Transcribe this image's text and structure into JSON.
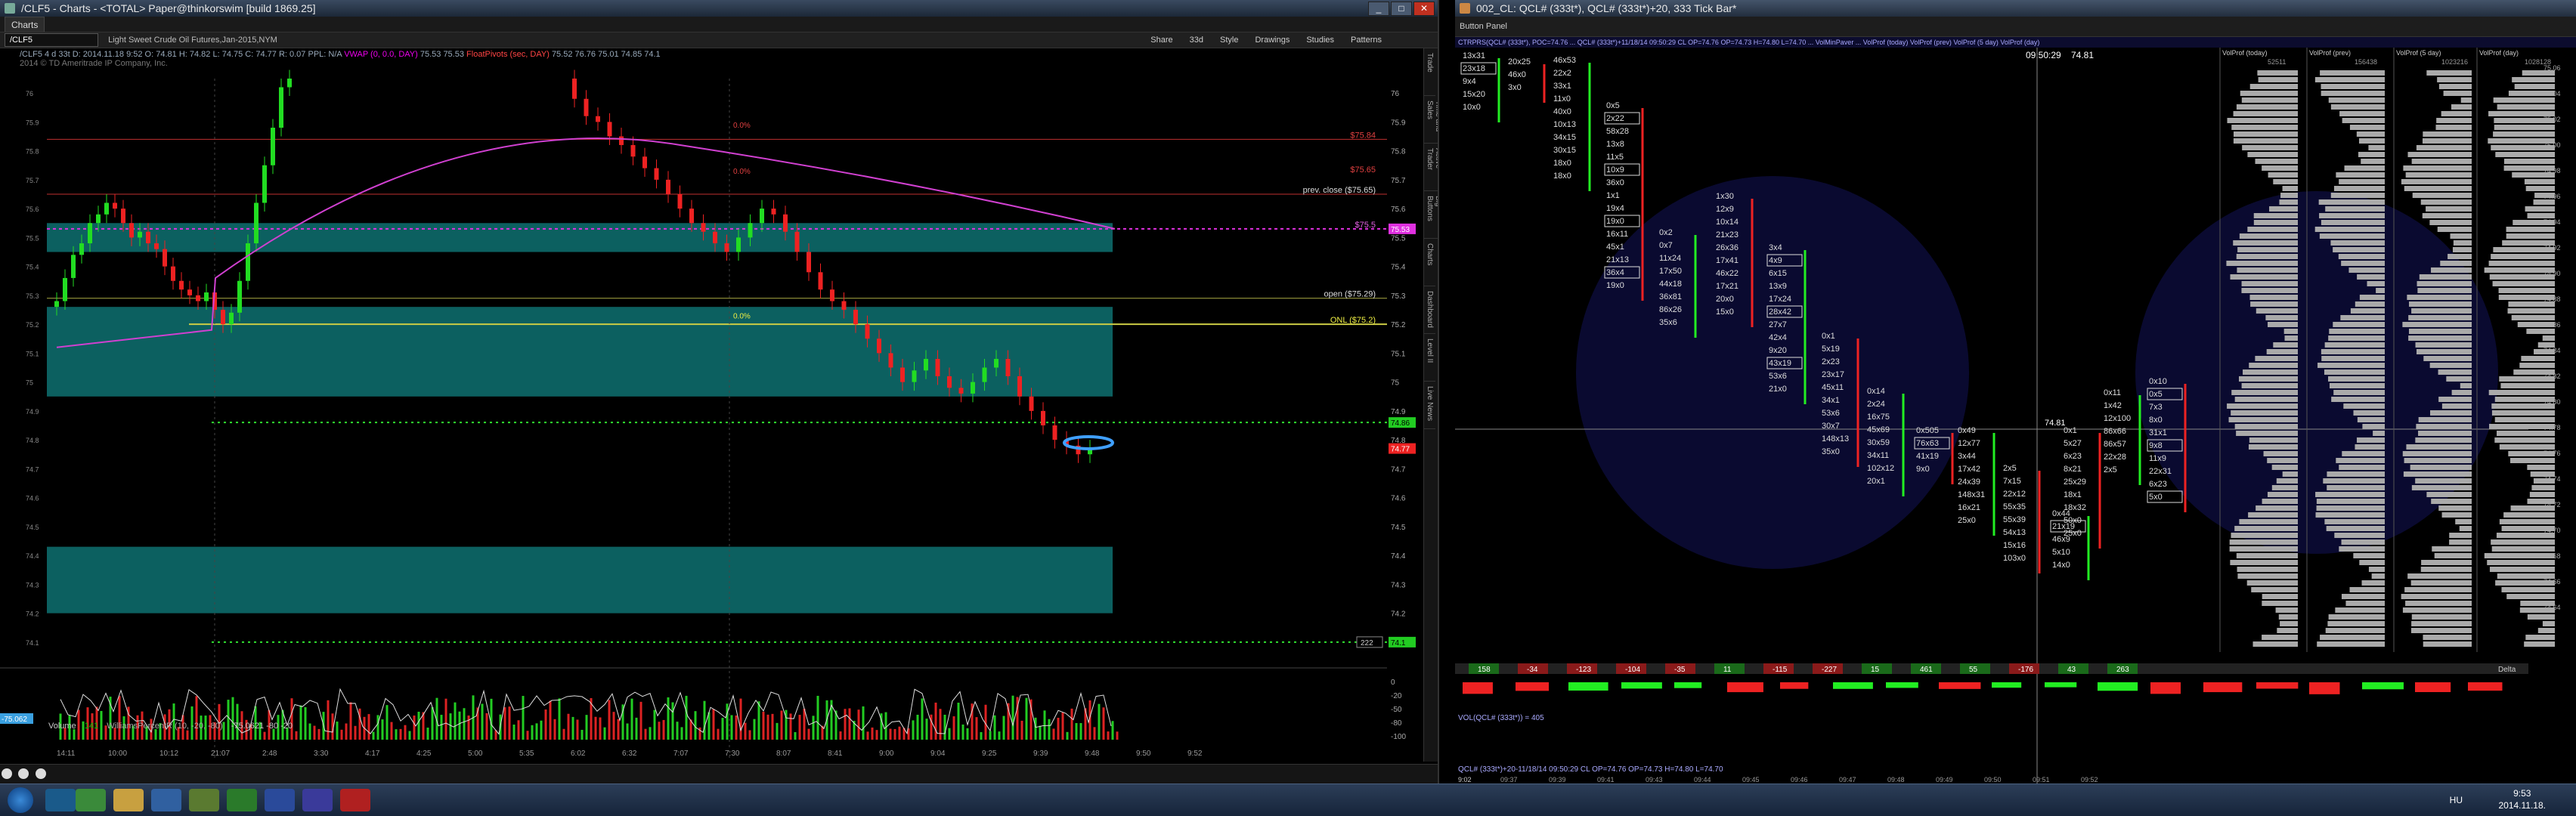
{
  "left_window": {
    "title": "/CLF5 - Charts - <TOTAL> Paper@thinkorswim [build 1869.25]",
    "tab": "Charts",
    "symbol": "/CLF5",
    "instrument": "Light Sweet Crude Oil Futures,Jan-2015,NYM",
    "toolbar": [
      "Share",
      "33d",
      "Style",
      "Drawings",
      "Studies",
      "Patterns"
    ],
    "quote": {
      "chart_name": "/CLF5 4 d 33t",
      "date": "D: 2014.11.18 9:52",
      "open": "O: 74.81",
      "high": "H: 74.82",
      "low": "L: 74.75",
      "close": "C: 74.77",
      "change": "R: 0.07",
      "ppl": "PPL: N/A",
      "vwap": "VWAP (0, 0.0, DAY)",
      "vwap_vals": "75.53  75.53",
      "pivots": "FloatPivots (sec, DAY)",
      "pivot_vals": "75.52  76.76  75.01  74.85  74.1"
    },
    "copyright": "2014 © TD Ameritrade IP Company, Inc.",
    "price_axis": [
      "76",
      "75.9",
      "75.8",
      "75.7",
      "75.6",
      "75.5",
      "75.4",
      "75.3",
      "75.2",
      "75.1",
      "75",
      "74.9",
      "74.8",
      "74.7",
      "74.6",
      "74.5",
      "74.4",
      "74.3",
      "74.2",
      "74.1"
    ],
    "annotations": {
      "prev_close": "prev. close ($75.65)",
      "open": "open ($75.29)",
      "onl": "ONL ($75.2)",
      "r1": "$75.84",
      "r2": "$75.65",
      "pct0": "0.0%",
      "pct1": "0.0%",
      "pct2": "0.0%",
      "level_tag": "$75.5"
    },
    "price_tags": {
      "current": "74.77",
      "magenta": "75.53",
      "green_dotted": "74.86",
      "bottom": "74.1",
      "bottom_small": "222"
    },
    "time_axis": [
      "14:11",
      "10:00",
      "10:12",
      "21:07",
      "2:48",
      "3:30",
      "4:17",
      "4:25",
      "5:00",
      "5:35",
      "6:02",
      "6:32",
      "7:07",
      "7:30",
      "8:07",
      "8:41",
      "9:00",
      "9:04",
      "9:25",
      "9:39",
      "9:48",
      "9:50",
      "9:52"
    ],
    "indicator": {
      "name": "Volume",
      "value": "141",
      "williams": "WilliamsPercentR (10, -20, -80)",
      "wr_vals": "-75.0621  -80  -20",
      "axis": [
        "0",
        "-20",
        "-50",
        "-80",
        "-100"
      ],
      "tag": "-75.062"
    },
    "side_tabs": [
      "Trade",
      "Time and Sales",
      "Active Trader",
      "Big Buttons",
      "Charts",
      "Dashboard",
      "Level II",
      "Live News"
    ]
  },
  "right_window": {
    "title": "002_CL: QCL# (333t*), QCL# (333t*)+20, 333 Tick Bar*",
    "menu": "Button Panel",
    "header_strip": "CTRPRS(QCL# (333t*), POC=74.76 ...  QCL# (333t*)+11/18/14 09:50:29 CL OP=74.76 OP=74.73 H=74.80 L=74.70  ...  VolMinPaver  ...  VolProf (today)  VolProf (prev)  VolProf (5 day)  VolProf (day)",
    "time_label": "09:50:29",
    "price_label": "74.81",
    "vp_headers": [
      "VolProf (today)",
      "VolProf (prev)",
      "VolProf (5 day)",
      "VolProf (day)"
    ],
    "vp_vals": [
      "52511",
      "156438",
      "1023216",
      "1028128"
    ],
    "price_axis": [
      "75.06",
      "75.04",
      "75.02",
      "75.00",
      "74.98",
      "74.96",
      "74.94",
      "74.92",
      "74.90",
      "74.88",
      "74.86",
      "74.84",
      "74.82",
      "74.80",
      "74.78",
      "74.76",
      "74.74",
      "74.72",
      "74.70",
      "74.68",
      "74.66",
      "74.64"
    ],
    "delta_values": [
      "158",
      "-34",
      "-123",
      "-104",
      "-35",
      "11",
      "-115",
      "-227",
      "15",
      "461",
      "55",
      "-176",
      "43",
      "263"
    ],
    "delta_label": "Delta",
    "vol_title": "VOL(QCL# (333t*)) = 405",
    "bottom_title": "QCL# (333t*)+20-11/18/14 09:50:29 CL OP=74.76 OP=74.73 H=74.80 L=74.70",
    "time_axis": [
      "09:37",
      "09:39",
      "09:41",
      "09:43",
      "09:44",
      "09:45",
      "09:46",
      "09:47",
      "09:48",
      "09:49",
      "09:50",
      "09:51",
      "09:52"
    ],
    "footer": "9:02",
    "footprint_cols": [
      {
        "cells": [
          "13x31",
          "23x18",
          "9x4",
          "15x20",
          "10x0"
        ]
      },
      {
        "cells": [
          "20x25",
          "46x0",
          "3x0"
        ]
      },
      {
        "cells": [
          "46x53",
          "22x2",
          "33x1",
          "11x0",
          "40x0",
          "10x13",
          "34x15",
          "30x15",
          "18x0",
          "18x0"
        ]
      },
      {
        "cells": [
          "0x5",
          "2x22",
          "58x28",
          "13x8",
          "11x5",
          "10x9",
          "36x0",
          "1x1",
          "19x4",
          "19x0",
          "16x11",
          "45x1",
          "21x13",
          "36x4",
          "19x0"
        ]
      },
      {
        "cells": [
          "0x2",
          "0x7",
          "11x24",
          "17x50",
          "44x18",
          "36x81",
          "86x26",
          "35x6"
        ]
      },
      {
        "cells": [
          "1x30",
          "12x9",
          "10x14",
          "21x23",
          "26x36",
          "17x41",
          "46x22",
          "17x21",
          "20x0",
          "15x0"
        ]
      },
      {
        "cells": [
          "3x4",
          "4x9",
          "6x15",
          "13x9",
          "17x24",
          "28x42",
          "27x7",
          "42x4",
          "9x20",
          "43x19",
          "53x6",
          "21x0"
        ]
      },
      {
        "cells": [
          "0x1",
          "5x19",
          "2x23",
          "23x17",
          "45x11",
          "34x1",
          "53x6",
          "30x7",
          "148x13",
          "35x0"
        ]
      },
      {
        "cells": [
          "0x14",
          "2x24",
          "16x75",
          "45x69",
          "30x59",
          "34x11",
          "102x12",
          "20x1"
        ]
      },
      {
        "cells": [
          "0x505",
          "76x63",
          "41x19",
          "9x0"
        ]
      },
      {
        "cells": [
          "0x49",
          "12x77",
          "3x44",
          "17x42",
          "24x39",
          "148x31",
          "16x21",
          "25x0"
        ]
      },
      {
        "cells": [
          "2x5",
          "7x15",
          "22x12",
          "55x35",
          "55x39",
          "54x13",
          "15x16",
          "103x0"
        ]
      },
      {
        "cells": [
          "0x44",
          "21x19",
          "46x9",
          "5x10",
          "14x0"
        ]
      },
      {
        "cells": [
          "0x1",
          "5x27",
          "6x23",
          "8x21",
          "25x29",
          "18x1",
          "18x32",
          "50x0",
          "25x0"
        ]
      },
      {
        "cells": [
          "0x11",
          "1x42",
          "12x100",
          "86x66",
          "86x57",
          "22x28",
          "2x5"
        ]
      },
      {
        "cells": [
          "0x10",
          "0x5",
          "7x3",
          "8x0",
          "31x1",
          "9x8",
          "11x9",
          "22x31",
          "6x23",
          "5x0"
        ]
      }
    ]
  },
  "taskbar": {
    "lang": "HU",
    "time": "9:53",
    "date": "2014.11.18."
  }
}
